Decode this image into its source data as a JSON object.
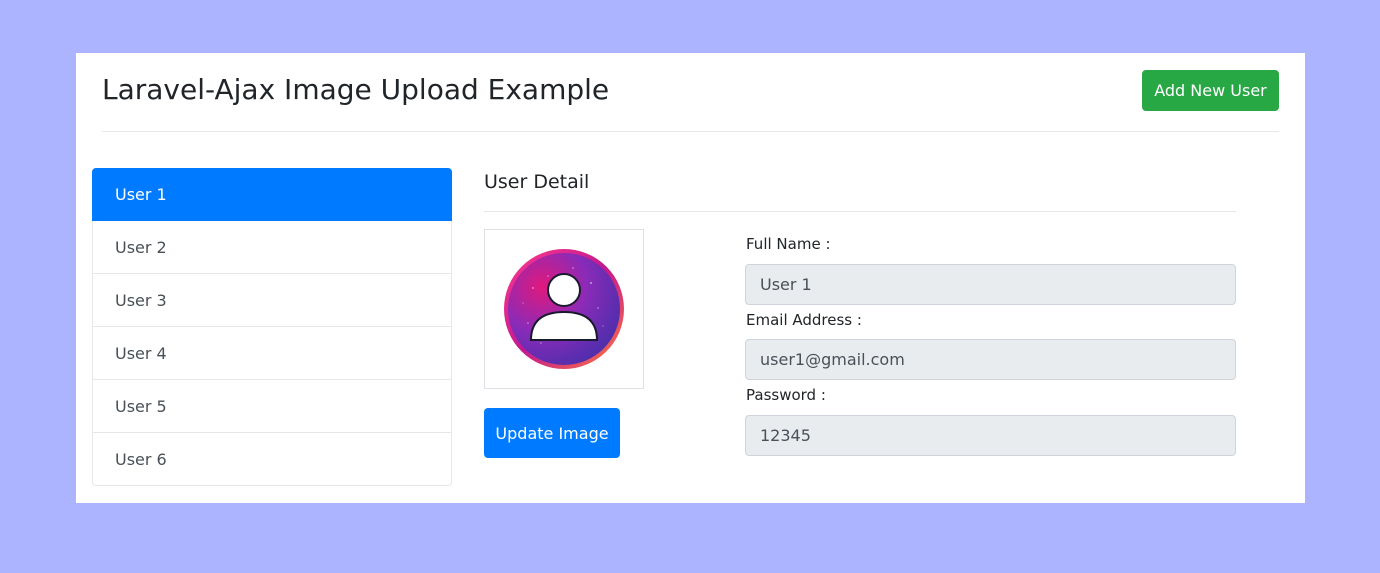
{
  "header": {
    "title": "Laravel-Ajax Image Upload Example",
    "add_button": "Add New User"
  },
  "users": [
    {
      "label": "User 1",
      "active": true
    },
    {
      "label": "User 2",
      "active": false
    },
    {
      "label": "User 3",
      "active": false
    },
    {
      "label": "User 4",
      "active": false
    },
    {
      "label": "User 5",
      "active": false
    },
    {
      "label": "User 6",
      "active": false
    }
  ],
  "detail": {
    "title": "User Detail",
    "image_icon": "user-avatar-icon",
    "update_button": "Update Image",
    "fields": {
      "full_name": {
        "label": "Full Name :",
        "value": "User 1"
      },
      "email": {
        "label": "Email Address :",
        "value": "user1@gmail.com"
      },
      "password": {
        "label": "Password :",
        "value": "12345"
      }
    }
  },
  "colors": {
    "page_background": "#adb4ff",
    "primary": "#007bff",
    "success": "#28a745",
    "readonly_input": "#e9ecef"
  }
}
